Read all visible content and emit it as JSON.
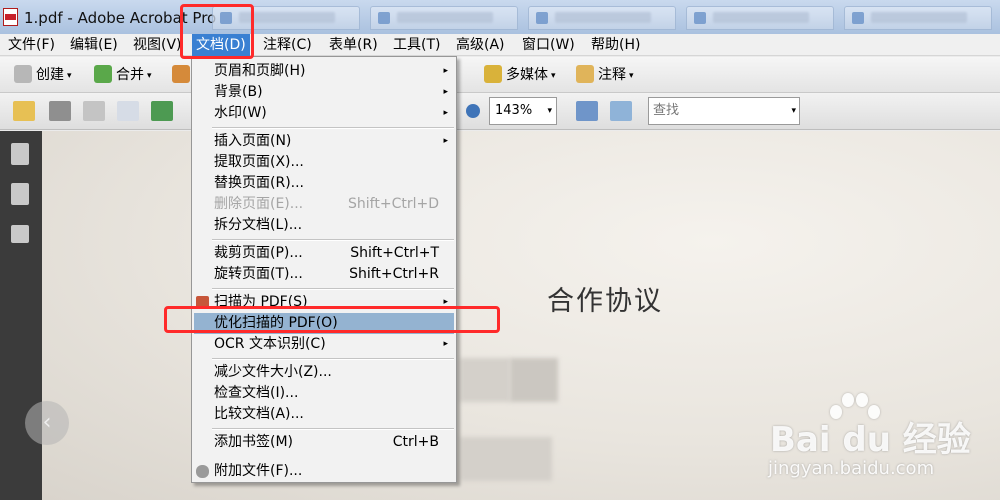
{
  "window": {
    "title": "1.pdf - Adobe Acrobat Pro"
  },
  "menubar": {
    "items": [
      {
        "label": "文件(F)"
      },
      {
        "label": "编辑(E)"
      },
      {
        "label": "视图(V)"
      },
      {
        "label": "文档(D)"
      },
      {
        "label": "注释(C)"
      },
      {
        "label": "表单(R)"
      },
      {
        "label": "工具(T)"
      },
      {
        "label": "高级(A)"
      },
      {
        "label": "窗口(W)"
      },
      {
        "label": "帮助(H)"
      }
    ]
  },
  "toolbar": {
    "create_label": "创建",
    "merge_label": "合并",
    "multimedia_label": "多媒体",
    "comment_label": "注释",
    "dropdown_glyph": "▾"
  },
  "view_toolbar": {
    "zoom_value": "143%",
    "search_placeholder": "查找",
    "dropdown_glyph": "▾"
  },
  "document_menu": {
    "groups": [
      [
        {
          "label": "页眉和页脚(H)",
          "submenu": true
        },
        {
          "label": "背景(B)",
          "submenu": true
        },
        {
          "label": "水印(W)",
          "submenu": true
        }
      ],
      [
        {
          "label": "插入页面(N)",
          "submenu": true
        },
        {
          "label": "提取页面(X)..."
        },
        {
          "label": "替换页面(R)..."
        },
        {
          "label": "删除页面(E)...",
          "shortcut": "Shift+Ctrl+D",
          "disabled": true
        },
        {
          "label": "拆分文档(L)..."
        }
      ],
      [
        {
          "label": "裁剪页面(P)...",
          "shortcut": "Shift+Ctrl+T"
        },
        {
          "label": "旋转页面(T)...",
          "shortcut": "Shift+Ctrl+R"
        }
      ],
      [
        {
          "label": "扫描为 PDF(S)",
          "submenu": true
        },
        {
          "label": "优化扫描的 PDF(O)",
          "highlighted": true
        },
        {
          "label": "OCR 文本识别(C)",
          "submenu": true
        }
      ],
      [
        {
          "label": "减少文件大小(Z)..."
        },
        {
          "label": "检查文档(I)..."
        },
        {
          "label": "比较文档(A)..."
        }
      ],
      [
        {
          "label": "添加书签(M)",
          "shortcut": "Ctrl+B"
        },
        {
          "label": "附加文件(F)..."
        }
      ]
    ],
    "submenu_glyph": "▸"
  },
  "document": {
    "title": "合作协议"
  },
  "watermark": {
    "logo_text": "Bai du 经验",
    "url_text": "jingyan.baidu.com"
  },
  "colors": {
    "menu_active": "#3a80d2",
    "menu_highlight": "#94b3d1",
    "annotation": "#ff2a2a"
  }
}
